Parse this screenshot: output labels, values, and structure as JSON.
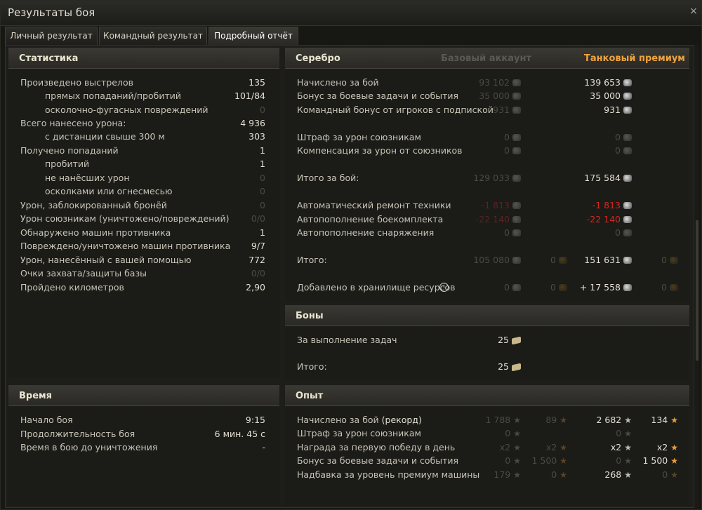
{
  "window": {
    "title": "Результаты боя",
    "close_glyph": "×"
  },
  "tabs": [
    {
      "label": "Личный результат",
      "active": false
    },
    {
      "label": "Командный результат",
      "active": false
    },
    {
      "label": "Подробный отчёт",
      "active": true
    }
  ],
  "statistics": {
    "header": "Статистика",
    "rows": [
      {
        "label": "Произведено выстрелов",
        "value": "135",
        "dim": false,
        "indent": false
      },
      {
        "label": "прямых попаданий/пробитий",
        "value": "101/84",
        "dim": false,
        "indent": true
      },
      {
        "label": "осколочно-фугасных повреждений",
        "value": "0",
        "dim": true,
        "indent": true
      },
      {
        "label": "Всего нанесено урона:",
        "value": "4 936",
        "dim": false,
        "indent": false
      },
      {
        "label": "с дистанции свыше 300 м",
        "value": "303",
        "dim": false,
        "indent": true
      },
      {
        "label": "Получено попаданий",
        "value": "1",
        "dim": false,
        "indent": false
      },
      {
        "label": "пробитий",
        "value": "1",
        "dim": false,
        "indent": true
      },
      {
        "label": "не нанёсших урон",
        "value": "0",
        "dim": true,
        "indent": true
      },
      {
        "label": "осколками или огнесмесью",
        "value": "0",
        "dim": true,
        "indent": true
      },
      {
        "label": "Урон, заблокированный бронёй",
        "value": "0",
        "dim": true,
        "indent": false
      },
      {
        "label": "Урон союзникам (уничтожено/повреждений)",
        "value": "0/0",
        "dim": true,
        "indent": false
      },
      {
        "label": "Обнаружено машин противника",
        "value": "1",
        "dim": false,
        "indent": false
      },
      {
        "label": "Повреждено/уничтожено машин противника",
        "value": "9/7",
        "dim": false,
        "indent": false
      },
      {
        "label": "Урон, нанесённый с вашей помощью",
        "value": "772",
        "dim": false,
        "indent": false
      },
      {
        "label": "Очки захвата/защиты базы",
        "value": "0/0",
        "dim": true,
        "indent": false
      },
      {
        "label": "Пройдено километров",
        "value": "2,90",
        "dim": false,
        "indent": false
      }
    ]
  },
  "time": {
    "header": "Время",
    "rows": [
      {
        "label": "Начало боя",
        "value": "9:15"
      },
      {
        "label": "Продолжительность боя",
        "value": "6 мин. 45 с"
      },
      {
        "label": "Время в бою до уничтожения",
        "value": "-"
      }
    ]
  },
  "silver": {
    "header": "Серебро",
    "col_base": "Базовый аккаунт",
    "col_premium": "Танковый премиум",
    "colors": {
      "premium_header": "#f0a33c",
      "base_header": "#5b5a52"
    },
    "rows": [
      {
        "label": "Начислено за бой",
        "base": "93 102",
        "prem": "139 653",
        "base_gold": null,
        "prem_gold": null,
        "red": false
      },
      {
        "label": "Бонус за боевые задачи и события",
        "base": "35 000",
        "prem": "35 000",
        "base_gold": null,
        "prem_gold": null,
        "red": false
      },
      {
        "label": "Командный бонус от игроков с подпиской",
        "base": "931",
        "prem": "931",
        "base_gold": null,
        "prem_gold": null,
        "red": false
      },
      {
        "label": "Штраф за урон союзникам",
        "base": "0",
        "prem": "0",
        "base_gold": null,
        "prem_gold": null,
        "red": false,
        "prem_dim": true
      },
      {
        "label": "Компенсация за урон от союзников",
        "base": "0",
        "prem": "0",
        "base_gold": null,
        "prem_gold": null,
        "red": false,
        "prem_dim": true
      },
      {
        "label": "Итого за бой:",
        "base": "129 033",
        "prem": "175 584",
        "base_gold": null,
        "prem_gold": null,
        "red": false
      },
      {
        "label": "Автоматический ремонт техники",
        "base": "-1 813",
        "prem": "-1 813",
        "base_gold": null,
        "prem_gold": null,
        "red": true
      },
      {
        "label": "Автопополнение боекомплекта",
        "base": "-22 140",
        "prem": "-22 140",
        "base_gold": null,
        "prem_gold": null,
        "red": true
      },
      {
        "label": "Автопополнение снаряжения",
        "base": "0",
        "prem": "0",
        "base_gold": null,
        "prem_gold": null,
        "red": false,
        "prem_dim": true
      },
      {
        "label": "Итого:",
        "base": "105 080",
        "prem": "151 631",
        "base_gold": "0",
        "prem_gold": "0",
        "red": false
      },
      {
        "label": "Добавлено в хранилище ресурсов",
        "base": "0",
        "prem": "+ 17 558",
        "base_gold": "0",
        "prem_gold": "0",
        "red": false,
        "info": true
      }
    ]
  },
  "bonds": {
    "header": "Боны",
    "rows": [
      {
        "label": "За выполнение задач",
        "value": "25"
      },
      {
        "label": "Итого:",
        "value": "25"
      }
    ]
  },
  "xp": {
    "header": "Опыт",
    "rows": [
      {
        "label": "Начислено за бой",
        "label_extra": " (рекорд)",
        "base": "1 788",
        "base_free": "89",
        "prem": "2 682",
        "prem_free": "134",
        "prem_dim": false,
        "pf_dim": false
      },
      {
        "label": "Штраф за урон союзникам",
        "label_extra": "",
        "base": "0",
        "base_free": "",
        "prem": "0",
        "prem_free": "",
        "prem_dim": true,
        "pf_dim": true
      },
      {
        "label": "Награда за первую победу в день",
        "label_extra": "",
        "base": "x2",
        "base_free": "x2",
        "prem": "x2",
        "prem_free": "x2",
        "prem_dim": false,
        "pf_dim": false
      },
      {
        "label": "Бонус за боевые задачи и события",
        "label_extra": "",
        "base": "0",
        "base_free": "1 500",
        "prem": "0",
        "prem_free": "1 500",
        "prem_dim": true,
        "pf_dim": false
      },
      {
        "label": "Надбавка за уровень премиум машины",
        "label_extra": "",
        "base": "179",
        "base_free": "0",
        "prem": "268",
        "prem_free": "0",
        "prem_dim": false,
        "pf_dim": true
      }
    ]
  }
}
